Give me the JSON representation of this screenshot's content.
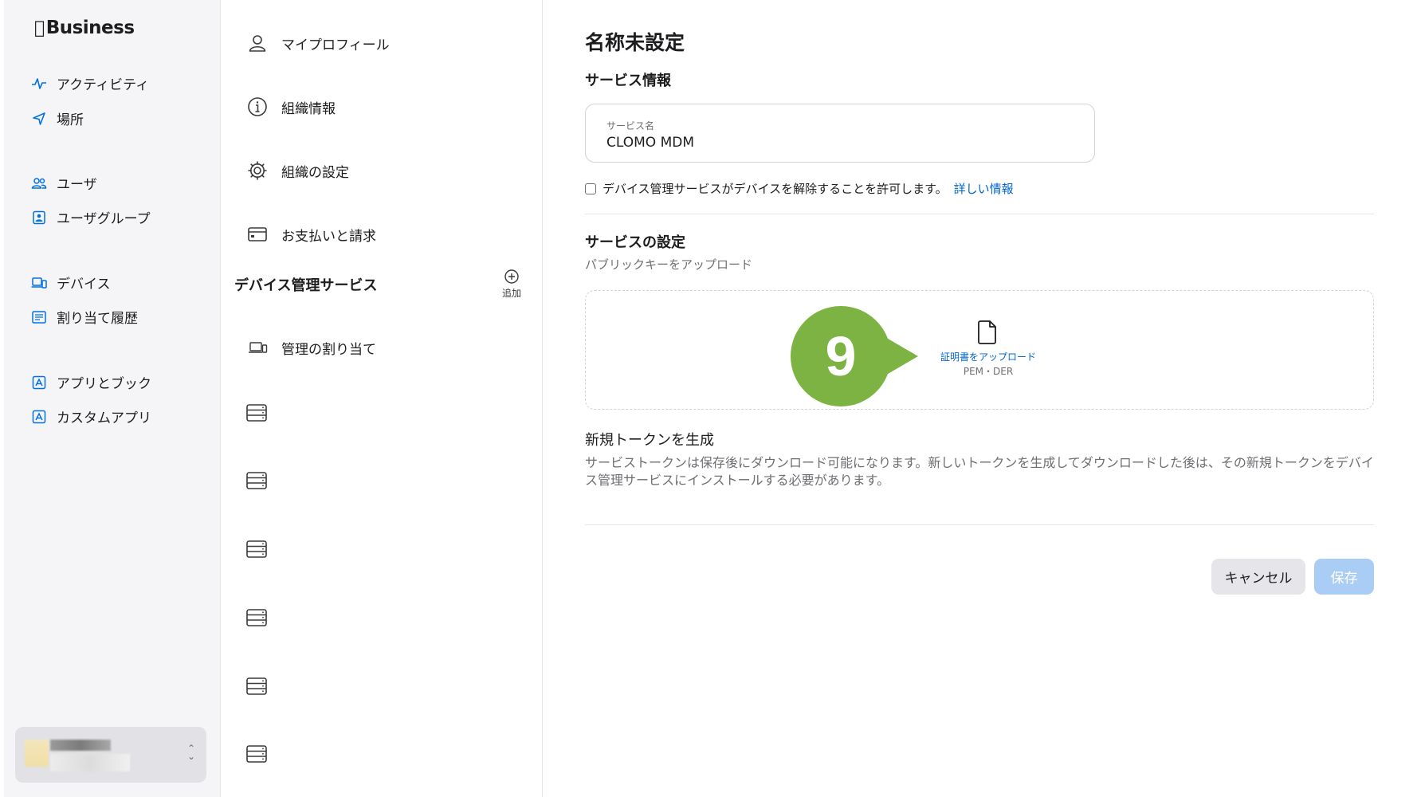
{
  "brand": {
    "name": "Business"
  },
  "left_nav": {
    "items": [
      {
        "label": "アクティビティ",
        "icon": "activity-icon"
      },
      {
        "label": "場所",
        "icon": "location-icon"
      },
      {
        "label": "ユーザ",
        "icon": "users-icon"
      },
      {
        "label": "ユーザグループ",
        "icon": "user-group-icon"
      },
      {
        "label": "デバイス",
        "icon": "devices-icon"
      },
      {
        "label": "割り当て履歴",
        "icon": "assignment-history-icon"
      },
      {
        "label": "アプリとブック",
        "icon": "apps-books-icon"
      },
      {
        "label": "カスタムアプリ",
        "icon": "custom-apps-icon"
      }
    ]
  },
  "mid_nav": {
    "items": [
      {
        "label": "マイプロフィール",
        "icon": "person-icon"
      },
      {
        "label": "組織情報",
        "icon": "info-icon"
      },
      {
        "label": "組織の設定",
        "icon": "gear-icon"
      },
      {
        "label": "お支払いと請求",
        "icon": "credit-card-icon"
      }
    ],
    "section_heading": "デバイス管理サービス",
    "add_label": "追加",
    "assign_label": "管理の割り当て"
  },
  "main": {
    "title": "名称未設定",
    "service_info_heading": "サービス情報",
    "service_name_label": "サービス名",
    "service_name_value": "CLOMO MDM",
    "release_checkbox_text": "デバイス管理サービスがデバイスを解除することを許可します。",
    "learn_more_link": "詳しい情報",
    "service_settings_heading": "サービスの設定",
    "upload_public_key_label": "パブリックキーをアップロード",
    "upload_certificate_link": "証明書をアップロード",
    "accepted_formats": "PEM・DER",
    "new_token_heading": "新規トークンを生成",
    "new_token_description": "サービストークンは保存後にダウンロード可能になります。新しいトークンを生成してダウンロードした後は、その新規トークンをデバイス管理サービスにインストールする必要があります。",
    "cancel_button": "キャンセル",
    "save_button": "保存"
  },
  "annotation": {
    "step_number": "9",
    "color": "#7cb342"
  },
  "colors": {
    "accent": "#0066cc",
    "save_disabled": "#a9cdf4"
  }
}
